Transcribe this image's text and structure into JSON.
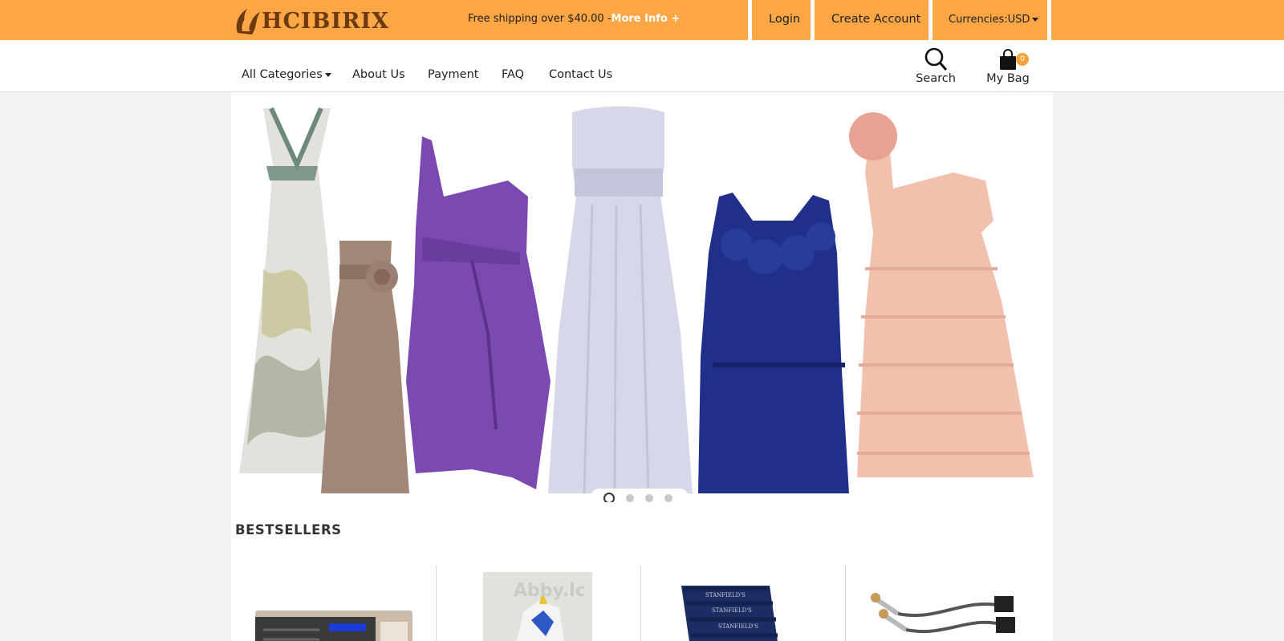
{
  "brand": {
    "name": "HCIBIRIX"
  },
  "topbar": {
    "shipping_text": "Free shipping over $40.00 -",
    "more_info": "More Info +",
    "login": "Login",
    "create_account": "Create Account",
    "currency": "Currencies:USD"
  },
  "nav": {
    "items": [
      "All Categories",
      "About Us",
      "Payment",
      "FAQ",
      "Contact Us"
    ],
    "search_label": "Search",
    "bag_label": "My Bag",
    "bag_count": "0"
  },
  "banner": {
    "slide_count": 4,
    "active_slide": 1,
    "dress_colors": [
      "#8d8d75",
      "#a08778",
      "#7a4ab0",
      "#d6d8ea",
      "#1f2f8a",
      "#f1c1ad"
    ]
  },
  "bestsellers": {
    "title": "BESTSELLERS",
    "products": [
      {
        "image": "network-storage-device"
      },
      {
        "image": "robot-figure",
        "watermark": "Abby.lc"
      },
      {
        "image": "underwear-pack",
        "label": "STANFIELD'S"
      },
      {
        "image": "oxygen-sensors"
      }
    ]
  },
  "colors": {
    "accent": "#fca645",
    "brand": "#6b3a12",
    "bag_badge": "#f7a13e"
  }
}
